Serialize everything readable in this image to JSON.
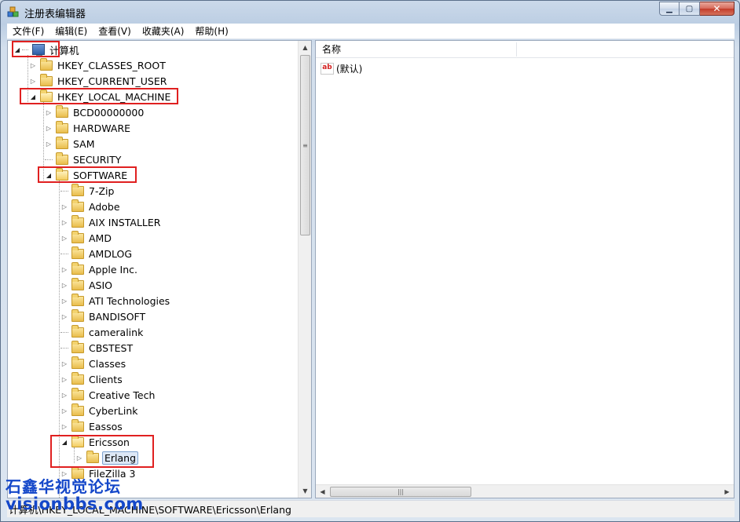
{
  "window": {
    "title": "注册表编辑器"
  },
  "menu": [
    {
      "label": "文件(F)"
    },
    {
      "label": "编辑(E)"
    },
    {
      "label": "查看(V)"
    },
    {
      "label": "收藏夹(A)"
    },
    {
      "label": "帮助(H)"
    }
  ],
  "tree": {
    "root": {
      "label": "计算机"
    },
    "hives": [
      {
        "label": "HKEY_CLASSES_ROOT"
      },
      {
        "label": "HKEY_CURRENT_USER"
      },
      {
        "label": "HKEY_LOCAL_MACHINE"
      }
    ],
    "hklm_children": [
      {
        "label": "BCD00000000"
      },
      {
        "label": "HARDWARE"
      },
      {
        "label": "SAM"
      },
      {
        "label": "SECURITY"
      },
      {
        "label": "SOFTWARE"
      }
    ],
    "software_children": [
      {
        "label": "7-Zip"
      },
      {
        "label": "Adobe"
      },
      {
        "label": "AIX INSTALLER"
      },
      {
        "label": "AMD"
      },
      {
        "label": "AMDLOG"
      },
      {
        "label": "Apple Inc."
      },
      {
        "label": "ASIO"
      },
      {
        "label": "ATI Technologies"
      },
      {
        "label": "BANDISOFT"
      },
      {
        "label": "cameralink"
      },
      {
        "label": "CBSTEST"
      },
      {
        "label": "Classes"
      },
      {
        "label": "Clients"
      },
      {
        "label": "Creative Tech"
      },
      {
        "label": "CyberLink"
      },
      {
        "label": "Eassos"
      },
      {
        "label": "Ericsson"
      },
      {
        "label": "FileZilla 3"
      }
    ],
    "ericsson_children": [
      {
        "label": "Erlang",
        "selected": true
      }
    ]
  },
  "values_pane": {
    "column_name": "名称",
    "rows": [
      {
        "name": "(默认)",
        "icon": "string-value-icon"
      }
    ]
  },
  "statusbar": {
    "path": "计算机\\HKEY_LOCAL_MACHINE\\SOFTWARE\\Ericsson\\Erlang"
  },
  "watermark": {
    "line1": "石鑫华视觉论坛",
    "line2": "visionbbs.com"
  },
  "colors": {
    "highlight_box": "#e02020",
    "watermark": "#1447c9",
    "selection": "#dde8f6"
  }
}
